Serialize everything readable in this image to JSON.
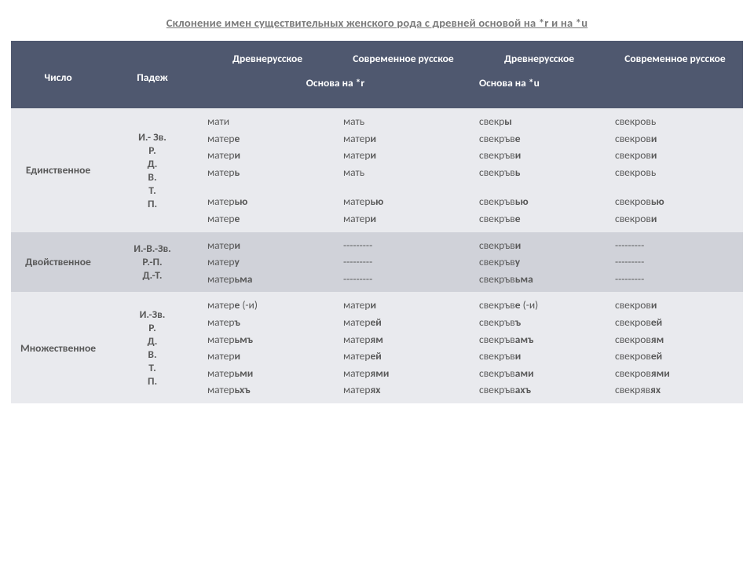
{
  "title": "Склонение имен существительных женского рода с древней основой на *r  и  на *u",
  "header": {
    "col_num": "Число",
    "col_case": "Падеж",
    "col_old1": "Древнерусское",
    "col_mod1": "Современное русское",
    "col_old2": "Древнерусское",
    "col_mod2": "Современное русское",
    "sub_r": "Основа на *r",
    "sub_u": "Основа на *u"
  },
  "rows": [
    {
      "name": "Единственное",
      "cases": "И.- Зв.\nР.\nД.\nВ.\nТ.\nП.",
      "c1": "мати\nматер<b>е</b>\nматер<b>и</b>\nматер<b>ь</b>\n<span class='spacer'></span>матер<b>ью</b>\nматер<b>е</b>",
      "c2": "мать\nматер<b>и</b>\nматер<b>и</b>\nмать\n<span class='spacer'></span>матер<b>ью</b>\nматер<b>и</b>",
      "c3": "свекр<b>ы</b>\nсвекръв<b>е</b>\nсвекръв<b>и</b>\nсвекръв<b>ь</b>\n<span class='spacer'></span>свекръв<b>ью</b>\nсвекръв<b>е</b>",
      "c4": "свекровь\nсвекров<b>и</b>\nсвекров<b>и</b>\nсвекровь\n<span class='spacer'></span>свекров<b>ью</b>\nсвекров<b>и</b>"
    },
    {
      "name": "Двойственное",
      "cases": "И.-В.-Зв.\nР.-П.\nД.-Т.",
      "c1": "матер<b>и</b>\nматер<b>у</b>\nматер<b>ьма</b>",
      "c2": "---------\n---------\n---------",
      "c3": "свекръв<b>и</b>\nсвекръв<b>у</b>\nсвекръв<b>ьма</b>",
      "c4": "---------\n---------\n---------"
    },
    {
      "name": "Множественное",
      "cases": "И.-Зв.\nР.\nД.\nВ.\nТ.\nП.",
      "c1": "матер<b>е</b> (-и)\n матер<b>ъ</b>\nматер<b>ьмъ</b>\nматер<b>и</b>\n матер<b>ьми</b>\nматер<b>ьхъ</b>",
      "c2": "матер<b>и</b>\n матер<b>ей</b>\nматер<b>ям</b>\nматер<b>ей</b>\n матер<b>ями</b>\nматер<b>ях</b>",
      "c3": "свекръв<b>е</b> (-и)\nсвекръв<b>ъ</b>\nсвекръв<b>амъ</b>\nсвекръв<b>и</b>\nсвекръв<b>ами</b>\nсвекръв<b>ахъ</b>",
      "c4": "свекров<b>и</b>\nсвекров<b>ей</b>\nсвекров<b>ям</b>\nсвекров<b>ей</b>\nсвекров<b>ями</b>\nсвекряв<b>ях</b>"
    }
  ]
}
